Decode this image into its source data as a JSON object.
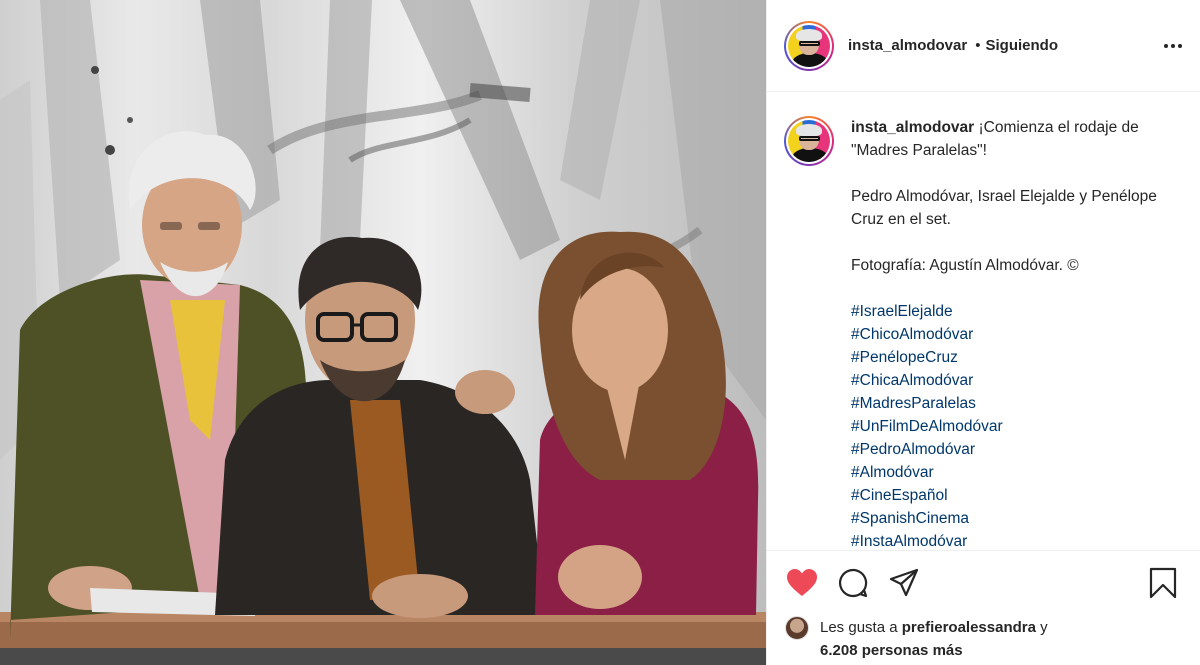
{
  "post": {
    "username": "insta_almodovar",
    "separator": "•",
    "follow_status": "Siguiendo"
  },
  "caption": {
    "username": "insta_almodovar",
    "line1": "¡Comienza el rodaje de \"Madres Paralelas\"!",
    "line2": "Pedro Almodóvar, Israel Elejalde y Penélope Cruz en el set.",
    "line3": "Fotografía: Agustín Almodóvar. ©",
    "hashtags": [
      "#IsraelElejalde",
      "#ChicoAlmodóvar",
      "#PenélopeCruz",
      "#ChicaAlmodóvar",
      "#MadresParalelas",
      "#UnFilmDeAlmodóvar",
      "#PedroAlmodóvar",
      "#Almodóvar",
      "#CineEspañol",
      "#SpanishCinema",
      "#InstaAlmodóvar"
    ]
  },
  "likes": {
    "prefix": "Les gusta a",
    "user": "prefieroalessandra",
    "joiner": "y",
    "count": "6.208 personas más"
  },
  "icons": {
    "like": "heart-filled-icon",
    "comment": "comment-icon",
    "share": "send-icon",
    "save": "bookmark-icon",
    "more": "more-horizontal-icon"
  },
  "colors": {
    "like_red": "#ed4956",
    "hashtag_blue": "#00376b",
    "text": "#262626",
    "divider": "#efefef"
  }
}
